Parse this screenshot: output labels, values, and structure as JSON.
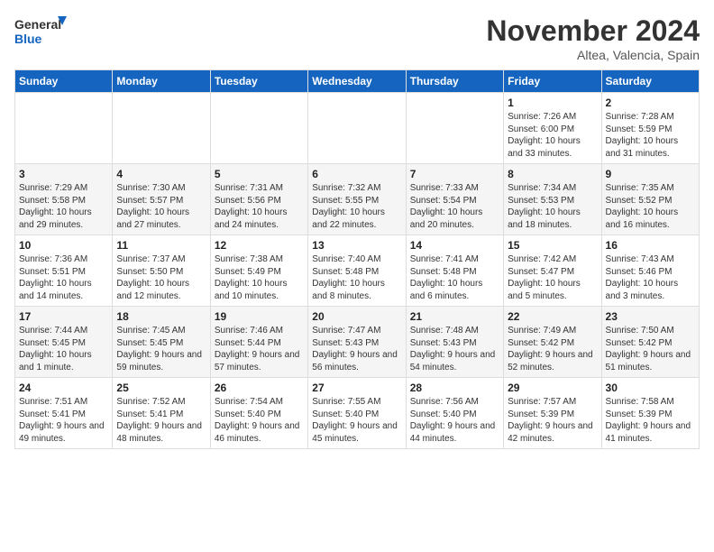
{
  "header": {
    "logo_general": "General",
    "logo_blue": "Blue",
    "month_title": "November 2024",
    "location": "Altea, Valencia, Spain"
  },
  "days_of_week": [
    "Sunday",
    "Monday",
    "Tuesday",
    "Wednesday",
    "Thursday",
    "Friday",
    "Saturday"
  ],
  "weeks": [
    [
      {
        "day": "",
        "info": ""
      },
      {
        "day": "",
        "info": ""
      },
      {
        "day": "",
        "info": ""
      },
      {
        "day": "",
        "info": ""
      },
      {
        "day": "",
        "info": ""
      },
      {
        "day": "1",
        "info": "Sunrise: 7:26 AM\nSunset: 6:00 PM\nDaylight: 10 hours and 33 minutes."
      },
      {
        "day": "2",
        "info": "Sunrise: 7:28 AM\nSunset: 5:59 PM\nDaylight: 10 hours and 31 minutes."
      }
    ],
    [
      {
        "day": "3",
        "info": "Sunrise: 7:29 AM\nSunset: 5:58 PM\nDaylight: 10 hours and 29 minutes."
      },
      {
        "day": "4",
        "info": "Sunrise: 7:30 AM\nSunset: 5:57 PM\nDaylight: 10 hours and 27 minutes."
      },
      {
        "day": "5",
        "info": "Sunrise: 7:31 AM\nSunset: 5:56 PM\nDaylight: 10 hours and 24 minutes."
      },
      {
        "day": "6",
        "info": "Sunrise: 7:32 AM\nSunset: 5:55 PM\nDaylight: 10 hours and 22 minutes."
      },
      {
        "day": "7",
        "info": "Sunrise: 7:33 AM\nSunset: 5:54 PM\nDaylight: 10 hours and 20 minutes."
      },
      {
        "day": "8",
        "info": "Sunrise: 7:34 AM\nSunset: 5:53 PM\nDaylight: 10 hours and 18 minutes."
      },
      {
        "day": "9",
        "info": "Sunrise: 7:35 AM\nSunset: 5:52 PM\nDaylight: 10 hours and 16 minutes."
      }
    ],
    [
      {
        "day": "10",
        "info": "Sunrise: 7:36 AM\nSunset: 5:51 PM\nDaylight: 10 hours and 14 minutes."
      },
      {
        "day": "11",
        "info": "Sunrise: 7:37 AM\nSunset: 5:50 PM\nDaylight: 10 hours and 12 minutes."
      },
      {
        "day": "12",
        "info": "Sunrise: 7:38 AM\nSunset: 5:49 PM\nDaylight: 10 hours and 10 minutes."
      },
      {
        "day": "13",
        "info": "Sunrise: 7:40 AM\nSunset: 5:48 PM\nDaylight: 10 hours and 8 minutes."
      },
      {
        "day": "14",
        "info": "Sunrise: 7:41 AM\nSunset: 5:48 PM\nDaylight: 10 hours and 6 minutes."
      },
      {
        "day": "15",
        "info": "Sunrise: 7:42 AM\nSunset: 5:47 PM\nDaylight: 10 hours and 5 minutes."
      },
      {
        "day": "16",
        "info": "Sunrise: 7:43 AM\nSunset: 5:46 PM\nDaylight: 10 hours and 3 minutes."
      }
    ],
    [
      {
        "day": "17",
        "info": "Sunrise: 7:44 AM\nSunset: 5:45 PM\nDaylight: 10 hours and 1 minute."
      },
      {
        "day": "18",
        "info": "Sunrise: 7:45 AM\nSunset: 5:45 PM\nDaylight: 9 hours and 59 minutes."
      },
      {
        "day": "19",
        "info": "Sunrise: 7:46 AM\nSunset: 5:44 PM\nDaylight: 9 hours and 57 minutes."
      },
      {
        "day": "20",
        "info": "Sunrise: 7:47 AM\nSunset: 5:43 PM\nDaylight: 9 hours and 56 minutes."
      },
      {
        "day": "21",
        "info": "Sunrise: 7:48 AM\nSunset: 5:43 PM\nDaylight: 9 hours and 54 minutes."
      },
      {
        "day": "22",
        "info": "Sunrise: 7:49 AM\nSunset: 5:42 PM\nDaylight: 9 hours and 52 minutes."
      },
      {
        "day": "23",
        "info": "Sunrise: 7:50 AM\nSunset: 5:42 PM\nDaylight: 9 hours and 51 minutes."
      }
    ],
    [
      {
        "day": "24",
        "info": "Sunrise: 7:51 AM\nSunset: 5:41 PM\nDaylight: 9 hours and 49 minutes."
      },
      {
        "day": "25",
        "info": "Sunrise: 7:52 AM\nSunset: 5:41 PM\nDaylight: 9 hours and 48 minutes."
      },
      {
        "day": "26",
        "info": "Sunrise: 7:54 AM\nSunset: 5:40 PM\nDaylight: 9 hours and 46 minutes."
      },
      {
        "day": "27",
        "info": "Sunrise: 7:55 AM\nSunset: 5:40 PM\nDaylight: 9 hours and 45 minutes."
      },
      {
        "day": "28",
        "info": "Sunrise: 7:56 AM\nSunset: 5:40 PM\nDaylight: 9 hours and 44 minutes."
      },
      {
        "day": "29",
        "info": "Sunrise: 7:57 AM\nSunset: 5:39 PM\nDaylight: 9 hours and 42 minutes."
      },
      {
        "day": "30",
        "info": "Sunrise: 7:58 AM\nSunset: 5:39 PM\nDaylight: 9 hours and 41 minutes."
      }
    ]
  ]
}
